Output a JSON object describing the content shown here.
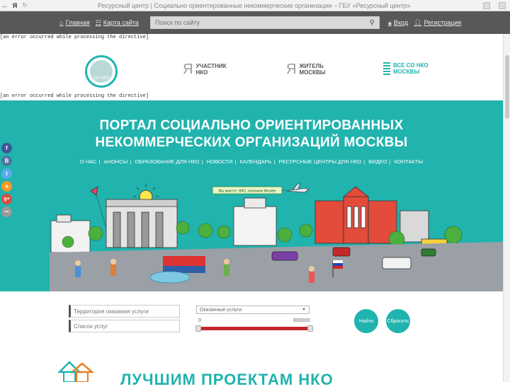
{
  "browser": {
    "back_icon": "arrow-left-icon",
    "brand": "Я",
    "page_title": "Ресурсный центр | Социально ориентированные некоммерческие организации – ГБУ «Ресурсный центр»"
  },
  "topnav": {
    "home_label": "Главная",
    "sitemap_label": "Карта сайта",
    "search_placeholder": "Поиск по сайту",
    "login_label": "Вход",
    "register_label": "Регистрация"
  },
  "errors": {
    "msg1": "[an error occurred while processing the directive]",
    "msg2": "[an error occurred while processing the directive]"
  },
  "header": {
    "logo_text": "СО НКО",
    "participant_line1": "УЧАСТНИК",
    "participant_line2": "НКО",
    "resident_line1": "ЖИТЕЛЬ",
    "resident_line2": "МОСКВЫ",
    "all_line1": "ВСЕ СО НКО",
    "all_line2": "МОСКВЫ"
  },
  "banner": {
    "title_line1": "ПОРТАЛ СОЦИАЛЬНО ОРИЕНТИРОВАННЫХ",
    "title_line2": "НЕКОММЕРЧЕСКИХ ОРГАНИЗАЦИЙ МОСКВЫ",
    "menu": [
      "О НАС",
      "АНОНСЫ",
      "ОБРАЗОВАНИЕ ДЛЯ НКО",
      "НОВОСТИ",
      "КАЛЕНДАРЬ",
      "РЕСУРСНЫЕ ЦЕНТРЫ ДЛЯ НКО",
      "ВИДЕО",
      "КОНТАКТЫ"
    ],
    "plane_banner": "Мы вместе, НКО, поможем Москве"
  },
  "social": [
    {
      "icon": "facebook-icon",
      "glyph": "f",
      "color": "#3b5998"
    },
    {
      "icon": "vk-icon",
      "glyph": "B",
      "color": "#4c75a3"
    },
    {
      "icon": "twitter-icon",
      "glyph": "t",
      "color": "#55acee"
    },
    {
      "icon": "odnoklassniki-icon",
      "glyph": "o",
      "color": "#f59a23"
    },
    {
      "icon": "googleplus-icon",
      "glyph": "g+",
      "color": "#dd4b39"
    },
    {
      "icon": "more-icon",
      "glyph": "•••",
      "color": "#9a9a9a"
    }
  ],
  "filters": {
    "territory_placeholder": "Территория оказания услуги",
    "services_placeholder": "Список услуг",
    "select_value": "Оказанные услуги",
    "range_min": "0",
    "range_max": "800000",
    "find_button": "Найти",
    "reset_button": "Сбросить"
  },
  "bottom": {
    "heading": "ЛУЧШИМ ПРОЕКТАМ НКО"
  },
  "colors": {
    "teal": "#21b3ae",
    "nav": "#585858",
    "red": "#c1272d"
  }
}
